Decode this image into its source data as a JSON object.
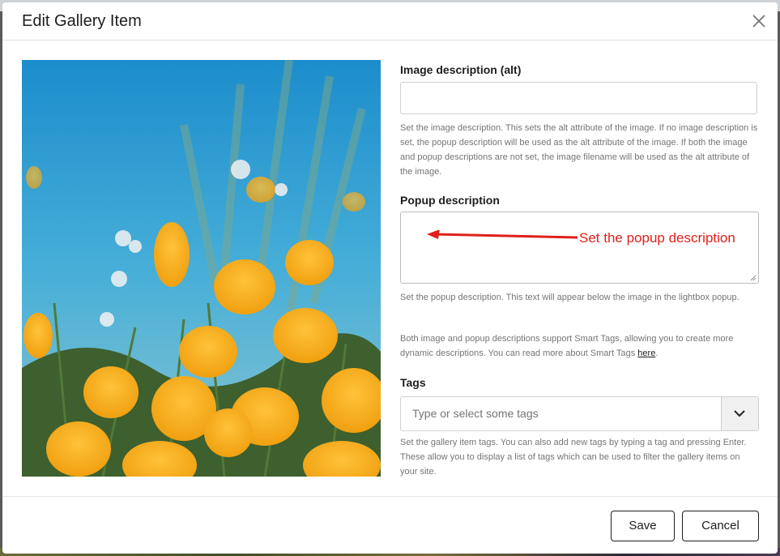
{
  "modal": {
    "title": "Edit Gallery Item",
    "close_icon": "close-icon"
  },
  "image": {
    "subject": "yellow-orange poppy flowers against blue sky"
  },
  "form": {
    "alt": {
      "label": "Image description (alt)",
      "value": "",
      "help": "Set the image description. This sets the alt attribute of the image. If no image description is set, the popup description will be used as the alt attribute of the image. If both the image and popup descriptions are not set, the image filename will be used as the alt attribute of the image."
    },
    "popup": {
      "label": "Popup description",
      "value": "",
      "annotation": "Set the popup description",
      "help": "Set the popup description. This text will appear below the image in the lightbox popup."
    },
    "smart_tags": {
      "help_prefix": "Both image and popup descriptions support Smart Tags, allowing you to create more dynamic descriptions. You can read more about Smart Tags ",
      "link": "here",
      "help_suffix": "."
    },
    "tags": {
      "label": "Tags",
      "placeholder": "Type or select some tags",
      "toggle_icon": "chevron-down-icon",
      "help": "Set the gallery item tags. You can also add new tags by typing a tag and pressing Enter. These allow you to display a list of tags which can be used to filter the gallery items on your site."
    }
  },
  "footer": {
    "save_label": "Save",
    "cancel_label": "Cancel"
  },
  "colors": {
    "annotation": "#e0201b",
    "text": "#1e1e1e",
    "muted": "#757575"
  }
}
